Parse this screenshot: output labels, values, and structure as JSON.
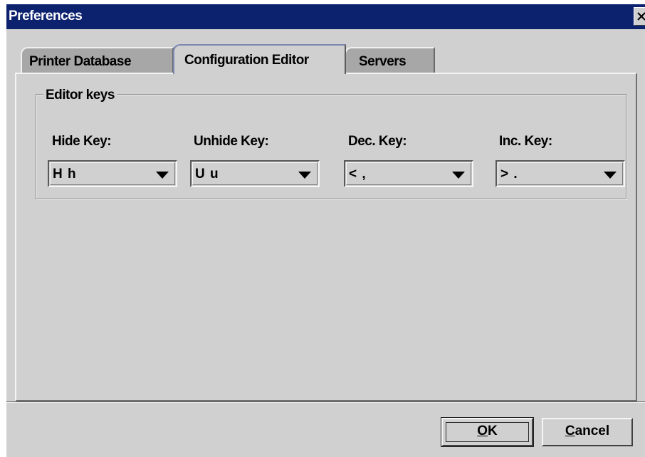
{
  "window": {
    "title": "Preferences",
    "close_icon": "close-icon"
  },
  "tabs": [
    {
      "label": "Printer Database",
      "selected": false
    },
    {
      "label": "Configuration Editor",
      "selected": true
    },
    {
      "label": "Servers",
      "selected": false
    }
  ],
  "editor_keys": {
    "legend": "Editor keys",
    "fields": [
      {
        "label": "Hide Key:",
        "value": "H h"
      },
      {
        "label": "Unhide Key:",
        "value": "U u"
      },
      {
        "label": "Dec. Key:",
        "value": "< ,"
      },
      {
        "label": "Inc. Key:",
        "value": "> ."
      }
    ]
  },
  "buttons": {
    "ok": {
      "mnemonic": "O",
      "rest": "K"
    },
    "cancel": {
      "mnemonic": "C",
      "rest": "ancel"
    }
  },
  "colors": {
    "titlebar": "#0c226e",
    "window_bg": "#d0d0d0",
    "inactive_tab": "#a7a7a7"
  }
}
